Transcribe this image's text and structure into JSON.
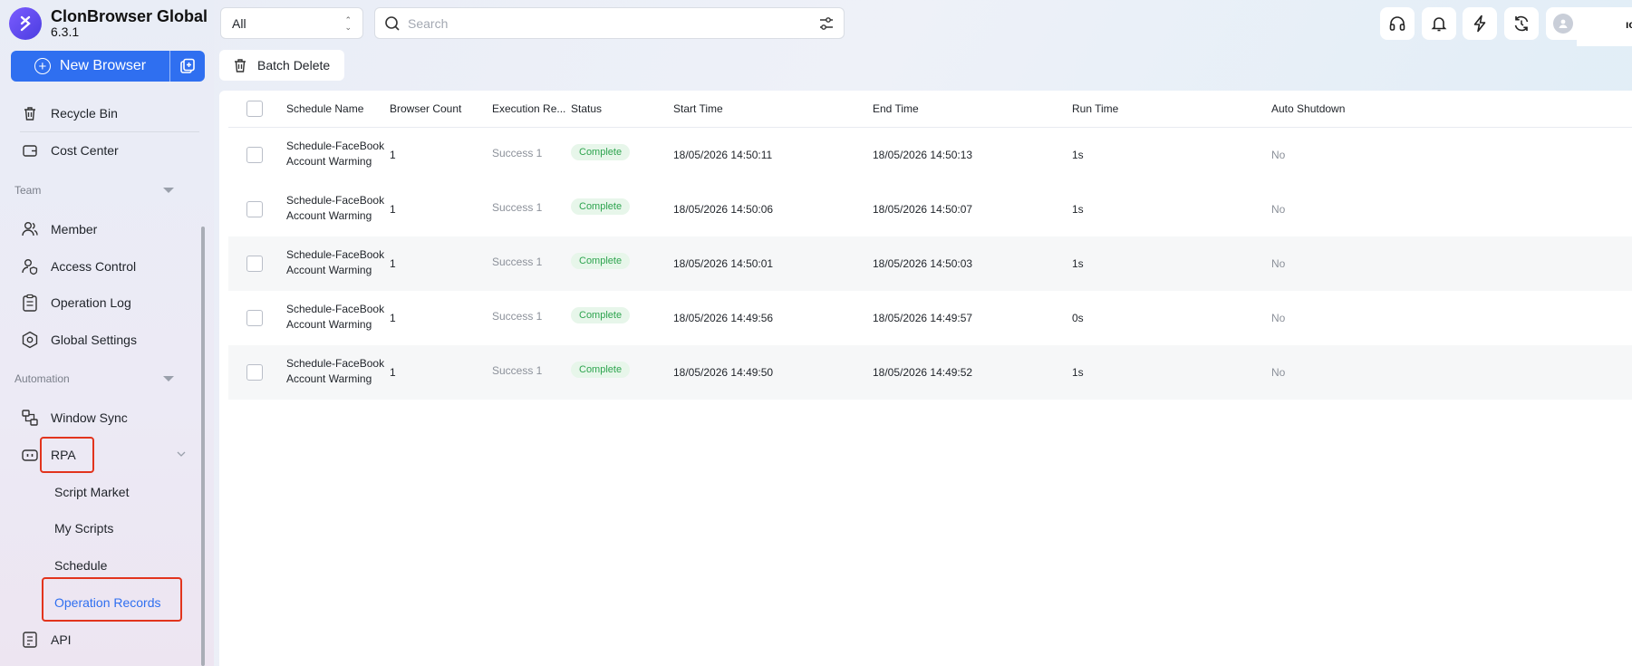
{
  "app": {
    "title": "ClonBrowser Global",
    "version": "6.3.1"
  },
  "sidebar": {
    "new_browser_label": "New Browser",
    "recycle_bin": "Recycle Bin",
    "cost_center": "Cost Center",
    "team_section": "Team",
    "member": "Member",
    "access_control": "Access Control",
    "operation_log": "Operation Log",
    "global_settings": "Global Settings",
    "automation_section": "Automation",
    "window_sync": "Window Sync",
    "rpa": "RPA",
    "script_market": "Script Market",
    "my_scripts": "My Scripts",
    "schedule": "Schedule",
    "operation_records": "Operation Records",
    "api": "API"
  },
  "toolbar": {
    "filter_value": "All",
    "search_placeholder": "Search",
    "batch_delete": "Batch Delete",
    "user_fragment": "ıc"
  },
  "table": {
    "columns": [
      "Schedule Name",
      "Browser Count",
      "Execution Re...",
      "Status",
      "Start Time",
      "End Time",
      "Run Time",
      "Auto Shutdown"
    ],
    "rows": [
      {
        "name1": "Schedule-FaceBook",
        "name2": "Account Warming",
        "count": "1",
        "exec": "Success 1",
        "status": "Complete",
        "start": "18/05/2026 14:50:11",
        "end": "18/05/2026 14:50:13",
        "run": "1s",
        "shutdown": "No"
      },
      {
        "name1": "Schedule-FaceBook",
        "name2": "Account Warming",
        "count": "1",
        "exec": "Success 1",
        "status": "Complete",
        "start": "18/05/2026 14:50:06",
        "end": "18/05/2026 14:50:07",
        "run": "1s",
        "shutdown": "No"
      },
      {
        "name1": "Schedule-FaceBook",
        "name2": "Account Warming",
        "count": "1",
        "exec": "Success 1",
        "status": "Complete",
        "start": "18/05/2026 14:50:01",
        "end": "18/05/2026 14:50:03",
        "run": "1s",
        "shutdown": "No"
      },
      {
        "name1": "Schedule-FaceBook",
        "name2": "Account Warming",
        "count": "1",
        "exec": "Success 1",
        "status": "Complete",
        "start": "18/05/2026 14:49:56",
        "end": "18/05/2026 14:49:57",
        "run": "0s",
        "shutdown": "No"
      },
      {
        "name1": "Schedule-FaceBook",
        "name2": "Account Warming",
        "count": "1",
        "exec": "Success 1",
        "status": "Complete",
        "start": "18/05/2026 14:49:50",
        "end": "18/05/2026 14:49:52",
        "run": "1s",
        "shutdown": "No"
      }
    ]
  },
  "colors": {
    "accent": "#2f6ff0",
    "highlight": "#e2341d",
    "status_green": "#2ea44f"
  }
}
